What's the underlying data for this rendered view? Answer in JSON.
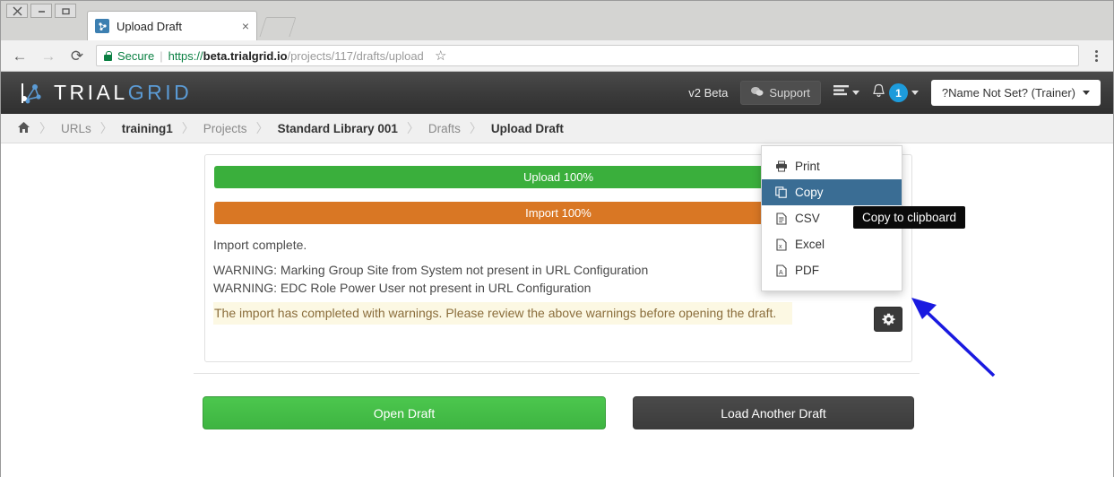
{
  "browser": {
    "window_controls": [
      "close",
      "minimize",
      "maximize"
    ],
    "tab": {
      "title": "Upload Draft",
      "favicon": "trialgrid-favicon",
      "close_label": "×"
    },
    "new_tab_label": "",
    "nav": {
      "back": "←",
      "forward": "→",
      "reload": "⟳"
    },
    "omnibox": {
      "secure_label": "Secure",
      "separator": "|",
      "url_scheme": "https://",
      "url_host": "beta.trialgrid.io",
      "url_path": "/projects/117/drafts/upload",
      "full_url": "https://beta.trialgrid.io/projects/117/drafts/upload"
    },
    "star_label": "☆",
    "menu_label": "kebab-menu"
  },
  "app": {
    "logo": {
      "text_primary": "TRIAL",
      "text_secondary": "GRID"
    },
    "version_label": "v2 Beta",
    "support_label": "Support",
    "notification_count": "1",
    "user_menu_label": "?Name Not Set? (Trainer)"
  },
  "breadcrumb": {
    "separator": "〉",
    "items": [
      {
        "label": "⌂",
        "name": "home",
        "strong": false,
        "is_home": true
      },
      {
        "label": "URLs",
        "name": "urls",
        "strong": false
      },
      {
        "label": "training1",
        "name": "training1",
        "strong": true
      },
      {
        "label": "Projects",
        "name": "projects",
        "strong": false
      },
      {
        "label": "Standard Library 001",
        "name": "standard-library-001",
        "strong": true
      },
      {
        "label": "Drafts",
        "name": "drafts",
        "strong": false
      },
      {
        "label": "Upload Draft",
        "name": "upload-draft",
        "strong": true
      }
    ]
  },
  "main": {
    "progress": [
      {
        "name": "upload",
        "label": "Upload 100%",
        "percent": 100,
        "color": "#3aaf3c"
      },
      {
        "name": "import",
        "label": "Import 100%",
        "percent": 100,
        "color": "#d97724"
      }
    ],
    "status_message": "Import complete.",
    "warnings": [
      "WARNING: Marking Group Site from System not present in URL Configuration",
      "WARNING: EDC Role Power User not present in URL Configuration"
    ],
    "warning_box": "The import has completed with warnings. Please review the above warnings before opening the draft.",
    "gear_button_label": "gear",
    "buttons": [
      {
        "name": "open-draft",
        "label": "Open Draft"
      },
      {
        "name": "load-another-draft",
        "label": "Load Another Draft"
      }
    ]
  },
  "dropdown": {
    "items": [
      {
        "label": "Print",
        "icon": "printer-icon",
        "active": false
      },
      {
        "label": "Copy",
        "icon": "copy-icon",
        "active": true
      },
      {
        "label": "CSV",
        "icon": "file-text-icon",
        "active": false
      },
      {
        "label": "Excel",
        "icon": "file-excel-icon",
        "active": false
      },
      {
        "label": "PDF",
        "icon": "file-pdf-icon",
        "active": false
      }
    ]
  },
  "tooltip": {
    "text": "Copy to clipboard"
  },
  "annotation": {
    "type": "arrow",
    "color": "#1a1ae0",
    "points_to": "gear-button"
  },
  "colors": {
    "accent_blue": "#1d9bdb",
    "success_green": "#3aaf3c",
    "warning_orange": "#d97724",
    "menu_highlight": "#3a6d94",
    "warning_bg": "#fcf8e3",
    "warning_text": "#8a6d3b",
    "logo_blue": "#5b9bd5"
  }
}
